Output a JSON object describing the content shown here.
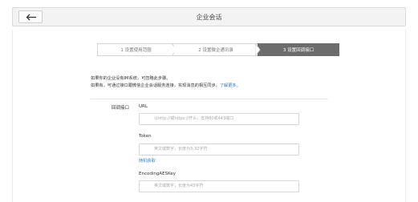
{
  "header": {
    "title": "企业会话",
    "back_icon": "arrow-left-icon"
  },
  "steps": [
    {
      "label": "1 设置使用范围",
      "active": false
    },
    {
      "label": "2 设置微企通讯录",
      "active": false
    },
    {
      "label": "3 设置回调接口",
      "active": true
    }
  ],
  "intro": {
    "line1": "如果你的企业没有IM系统，可忽略此步骤。",
    "line2": "如果有，可通过接口跟微信企业会话服务连接，实现消息的相互同步。",
    "learn_more": "了解更多。"
  },
  "form": {
    "section_label": "回调接口",
    "url": {
      "label": "URL",
      "placeholder": "以http://或https://开头，支持80或443端口"
    },
    "token": {
      "label": "Token",
      "placeholder": "英文或数字，长度为3-32字符"
    },
    "random_get": "随机获取",
    "aes": {
      "label": "EncodingAESKey",
      "placeholder": "英文或数字，长度为43字符"
    }
  },
  "colors": {
    "active_step": "#6c6c6c",
    "link": "#3a7bd5"
  }
}
